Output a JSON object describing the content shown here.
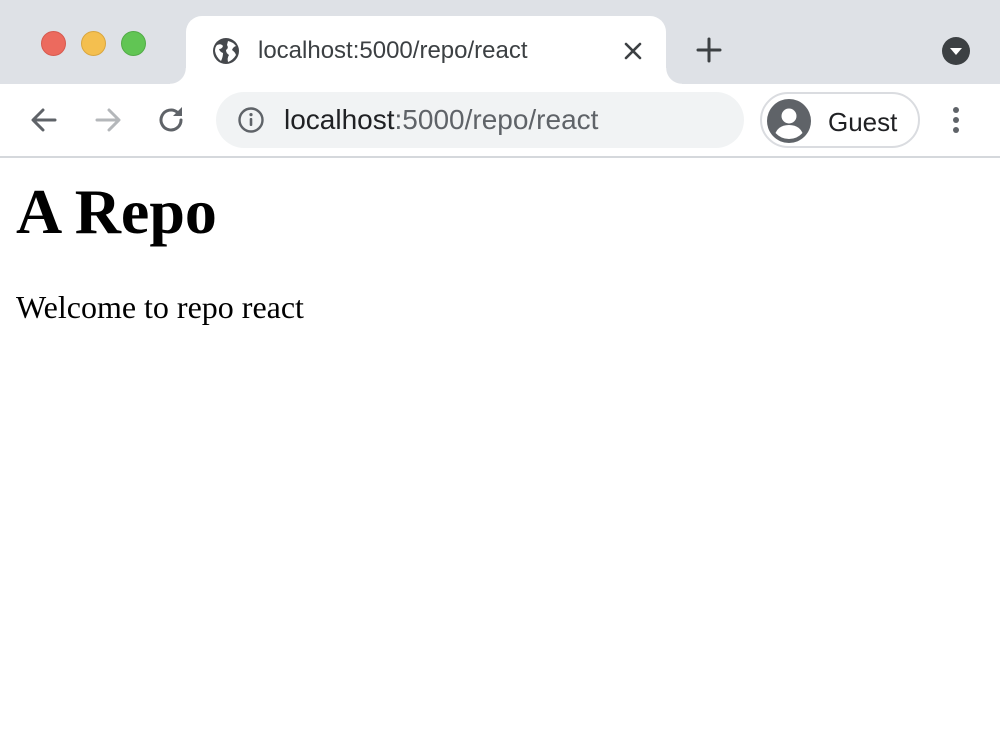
{
  "browser": {
    "tab": {
      "title": "localhost:5000/repo/react",
      "favicon": "globe-icon"
    },
    "address_bar": {
      "host": "localhost",
      "path": ":5000/repo/react",
      "security_icon": "info-icon"
    },
    "profile": {
      "name": "Guest",
      "avatar": "account-icon"
    },
    "colors": {
      "tabstrip": "#dee1e6",
      "omnibox": "#f1f3f4",
      "traffic_close": "#ec6a5e",
      "traffic_minimize": "#f4bf4f",
      "traffic_maximize": "#61c554"
    }
  },
  "page": {
    "heading": "A Repo",
    "text": "Welcome to repo react"
  }
}
